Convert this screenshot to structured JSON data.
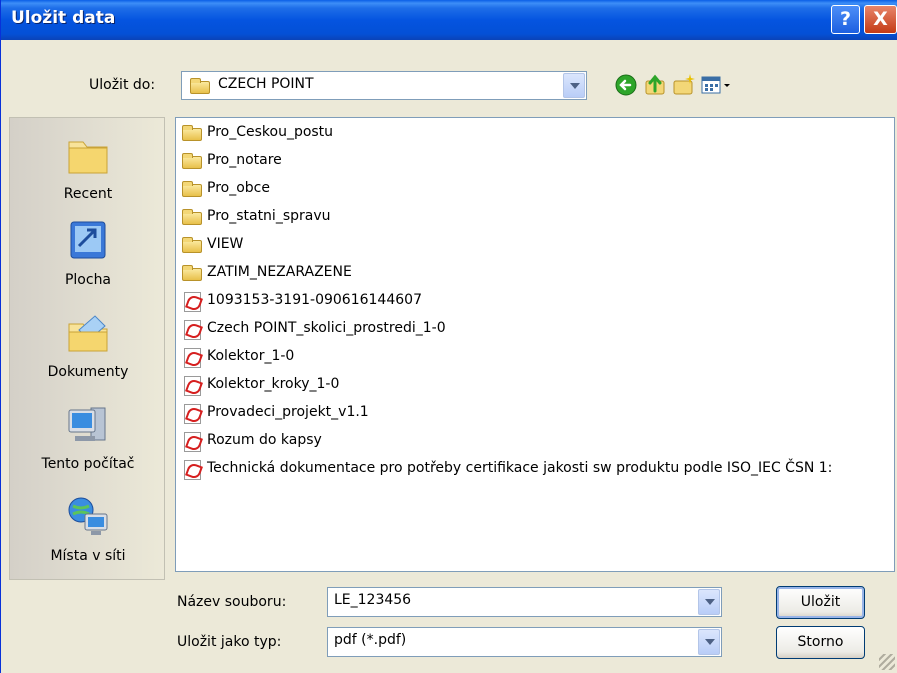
{
  "dialog": {
    "title": "Uložit data",
    "help_label": "?",
    "close_label": "X"
  },
  "save_in": {
    "label": "Uložit do:",
    "value": "CZECH POINT"
  },
  "toolbar": {
    "back_icon": "back-arrow-icon",
    "up_icon": "up-folder-icon",
    "new_folder_icon": "new-folder-icon",
    "views_icon": "views-menu-icon"
  },
  "places": [
    {
      "label": "Recent",
      "icon": "recent-folder-icon"
    },
    {
      "label": "Plocha",
      "icon": "desktop-icon"
    },
    {
      "label": "Dokumenty",
      "icon": "documents-icon"
    },
    {
      "label": "Tento počítač",
      "icon": "computer-icon"
    },
    {
      "label": "Místa v síti",
      "icon": "network-icon"
    }
  ],
  "files": [
    {
      "name": "Pro_Ceskou_postu",
      "type": "folder"
    },
    {
      "name": "Pro_notare",
      "type": "folder"
    },
    {
      "name": "Pro_obce",
      "type": "folder"
    },
    {
      "name": "Pro_statni_spravu",
      "type": "folder"
    },
    {
      "name": "VIEW",
      "type": "folder"
    },
    {
      "name": "ZATIM_NEZARAZENE",
      "type": "folder"
    },
    {
      "name": "1093153-3191-090616144607",
      "type": "pdf"
    },
    {
      "name": "Czech POINT_skolici_prostredi_1-0",
      "type": "pdf"
    },
    {
      "name": "Kolektor_1-0",
      "type": "pdf"
    },
    {
      "name": "Kolektor_kroky_1-0",
      "type": "pdf"
    },
    {
      "name": "Provadeci_projekt_v1.1",
      "type": "pdf"
    },
    {
      "name": "Rozum do kapsy",
      "type": "pdf"
    },
    {
      "name": "Technická dokumentace pro potřeby certifikace jakosti sw produktu podle ISO_IEC ČSN 1:",
      "type": "pdf"
    }
  ],
  "filename": {
    "label": "Název souboru:",
    "value": "LE_123456"
  },
  "filetype": {
    "label": "Uložit jako typ:",
    "value": "pdf (*.pdf)"
  },
  "buttons": {
    "save": "Uložit",
    "cancel": "Storno"
  }
}
